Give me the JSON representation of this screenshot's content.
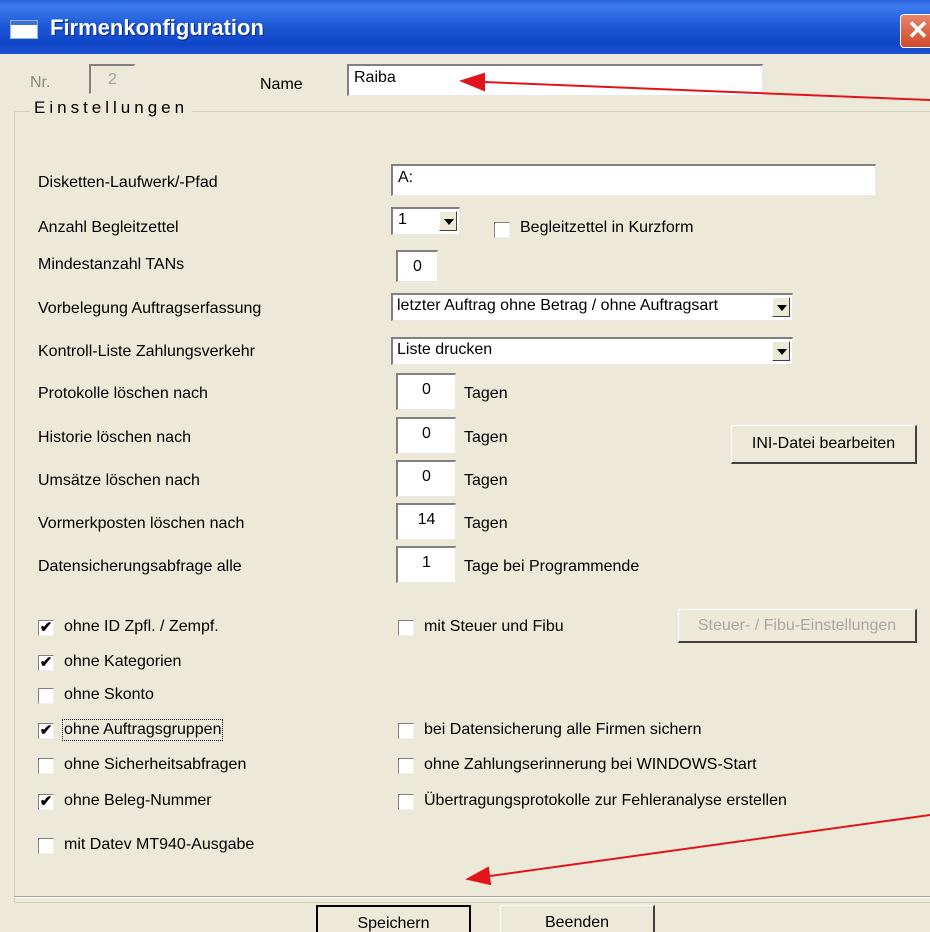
{
  "window": {
    "title": "Firmenkonfiguration",
    "close": "✕"
  },
  "header": {
    "nr_label": "Nr.",
    "nr_value": "2",
    "name_label": "Name",
    "name_value": "Raiba"
  },
  "group_title": "Einstellungen",
  "settings": {
    "disk_label": "Disketten-Laufwerk/-Pfad",
    "disk_value": "A:",
    "begleit_label": "Anzahl Begleitzettel",
    "begleit_value": "1",
    "begleit_kurz_label": "Begleitzettel in Kurzform",
    "tan_label": "Mindestanzahl TANs",
    "tan_value": "0",
    "vorbelegung_label": "Vorbelegung Auftragserfassung",
    "vorbelegung_value": "letzter Auftrag ohne Betrag / ohne Auftragsart",
    "kontroll_label": "Kontroll-Liste Zahlungsverkehr",
    "kontroll_value": "Liste drucken",
    "protokolle_label": "Protokolle löschen nach",
    "protokolle_value": "0",
    "historie_label": "Historie löschen nach",
    "historie_value": "0",
    "umsaetze_label": "Umsätze löschen nach",
    "umsaetze_value": "0",
    "vormerk_label": "Vormerkposten löschen nach",
    "vormerk_value": "14",
    "datensich_label": "Datensicherungsabfrage alle",
    "datensich_value": "1",
    "tagen": "Tagen",
    "tage_programmende": "Tage bei Programmende",
    "ini_button": "INI-Datei bearbeiten"
  },
  "options_left": [
    {
      "label": "ohne ID Zpfl. / Zempf.",
      "checked": true
    },
    {
      "label": "ohne Kategorien",
      "checked": true
    },
    {
      "label": "ohne Skonto",
      "checked": false
    },
    {
      "label": "ohne Auftragsgruppen",
      "checked": true
    },
    {
      "label": "ohne Sicherheitsabfragen",
      "checked": false
    },
    {
      "label": "ohne Beleg-Nummer",
      "checked": true
    },
    {
      "label": "mit Datev MT940-Ausgabe",
      "checked": false
    }
  ],
  "options_right": [
    {
      "label": "mit Steuer und Fibu",
      "checked": false
    },
    {
      "label": "bei Datensicherung alle Firmen sichern",
      "checked": false
    },
    {
      "label": "ohne Zahlungserinnerung bei WINDOWS-Start",
      "checked": false
    },
    {
      "label": "Übertragungsprotokolle zur Fehleranalyse erstellen",
      "checked": false
    }
  ],
  "steuer_button": "Steuer- / Fibu-Einstellungen",
  "buttons": {
    "save": "Speichern",
    "quit": "Beenden"
  },
  "colors": {
    "titlebar": "#0e46c8",
    "annotation_arrow": "#e0141a",
    "dialog_bg": "#ece9d8"
  }
}
